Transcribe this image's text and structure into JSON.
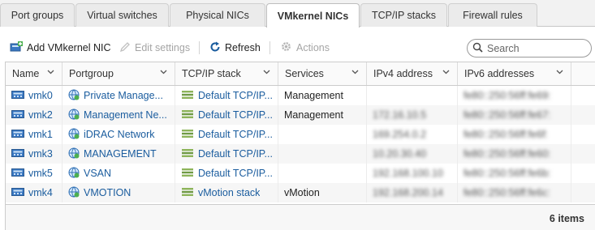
{
  "tabs": [
    {
      "label": "Port groups",
      "active": false
    },
    {
      "label": "Virtual switches",
      "active": false
    },
    {
      "label": "Physical NICs",
      "active": false
    },
    {
      "label": "VMkernel NICs",
      "active": true
    },
    {
      "label": "TCP/IP stacks",
      "active": false
    },
    {
      "label": "Firewall rules",
      "active": false
    }
  ],
  "toolbar": {
    "add_label": "Add VMkernel NIC",
    "edit_label": "Edit settings",
    "refresh_label": "Refresh",
    "actions_label": "Actions",
    "search_placeholder": "Search"
  },
  "table": {
    "columns": [
      "Name",
      "Portgroup",
      "TCP/IP stack",
      "Services",
      "IPv4 address",
      "IPv6 addresses"
    ],
    "rows": [
      {
        "name": "vmk0",
        "portgroup": "Private Manage...",
        "stack": "Default TCP/IP...",
        "services": "Management",
        "ipv4": "",
        "ipv6": "fe80::250:56ff:fe69:"
      },
      {
        "name": "vmk2",
        "portgroup": "Management Ne...",
        "stack": "Default TCP/IP...",
        "services": "Management",
        "ipv4": "172.16.10.5",
        "ipv6": "fe80::250:56ff:fe67:"
      },
      {
        "name": "vmk1",
        "portgroup": "iDRAC Network",
        "stack": "Default TCP/IP...",
        "services": "",
        "ipv4": "169.254.0.2",
        "ipv6": "fe80::250:56ff:fe6f:"
      },
      {
        "name": "vmk3",
        "portgroup": "MANAGEMENT",
        "stack": "Default TCP/IP...",
        "services": "",
        "ipv4": "10.20.30.40",
        "ipv6": "fe80::250:56ff:fe60:"
      },
      {
        "name": "vmk5",
        "portgroup": "VSAN",
        "stack": "Default TCP/IP...",
        "services": "",
        "ipv4": "192.168.100.10",
        "ipv6": "fe80::250:56ff:fe6b:"
      },
      {
        "name": "vmk4",
        "portgroup": "VMOTION",
        "stack": "vMotion stack",
        "services": "vMotion",
        "ipv4": "192.168.200.14",
        "ipv6": "fe80::250:56ff:fe6c:"
      }
    ]
  },
  "footer": {
    "count": "6 items"
  },
  "colors": {
    "link": "#1a5c9e",
    "nic_icon": "#3a78c2",
    "portgroup_icon": "#3c8f3c",
    "stack_icon": "#7a9a4a"
  }
}
